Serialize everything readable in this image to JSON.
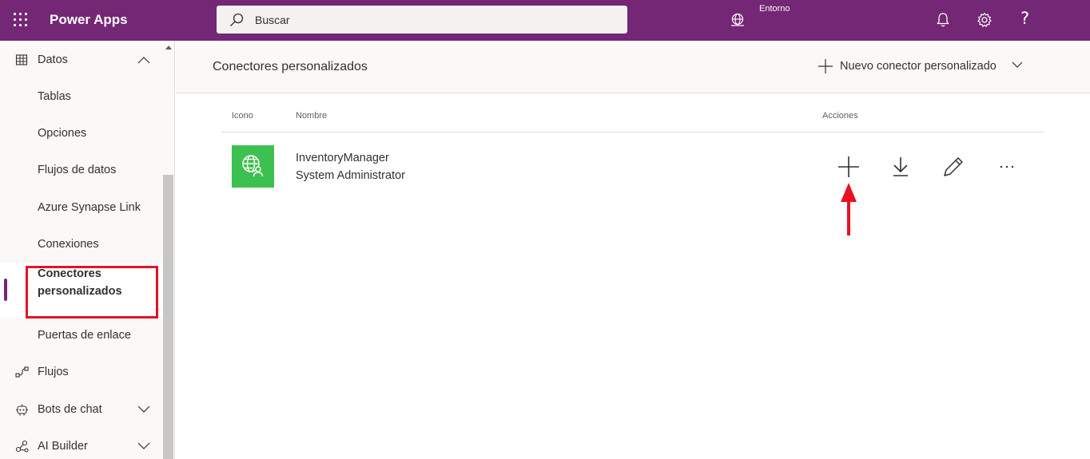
{
  "header": {
    "app_title": "Power Apps",
    "search_placeholder": "Buscar",
    "environment_label": "Entorno",
    "help_label": "?",
    "icons": [
      "waffle-icon",
      "search-icon",
      "environment-icon",
      "bell-icon",
      "settings-icon",
      "help-icon"
    ]
  },
  "sidebar": {
    "items": [
      {
        "label": "Datos",
        "icon": "table-icon",
        "expanded": true
      },
      {
        "label": "Tablas"
      },
      {
        "label": "Opciones"
      },
      {
        "label": "Flujos de datos"
      },
      {
        "label": "Azure Synapse Link"
      },
      {
        "label": "Conexiones"
      },
      {
        "label": "Conectores personalizados",
        "line1": "Conectores",
        "line2": "personalizados",
        "selected": true
      },
      {
        "label": "Puertas de enlace"
      },
      {
        "label": "Flujos",
        "icon": "flow-icon"
      },
      {
        "label": "Bots de chat",
        "icon": "bot-icon"
      },
      {
        "label": "AI Builder",
        "icon": "ai-builder-icon"
      }
    ]
  },
  "main": {
    "title": "Conectores personalizados",
    "new_button_label": "Nuevo conector personalizado",
    "columns": {
      "icon": "Icono",
      "name": "Nombre",
      "actions": "Acciones"
    },
    "rows": [
      {
        "name": "InventoryManager",
        "owner": "System Administrator",
        "icon": "globe-user-icon",
        "actions": [
          "add-icon",
          "download-icon",
          "edit-icon",
          "more-icon"
        ]
      }
    ]
  },
  "colors": {
    "brand": "#742774",
    "connector_icon_bg": "#3cc150",
    "annotation_red": "#e81123"
  }
}
